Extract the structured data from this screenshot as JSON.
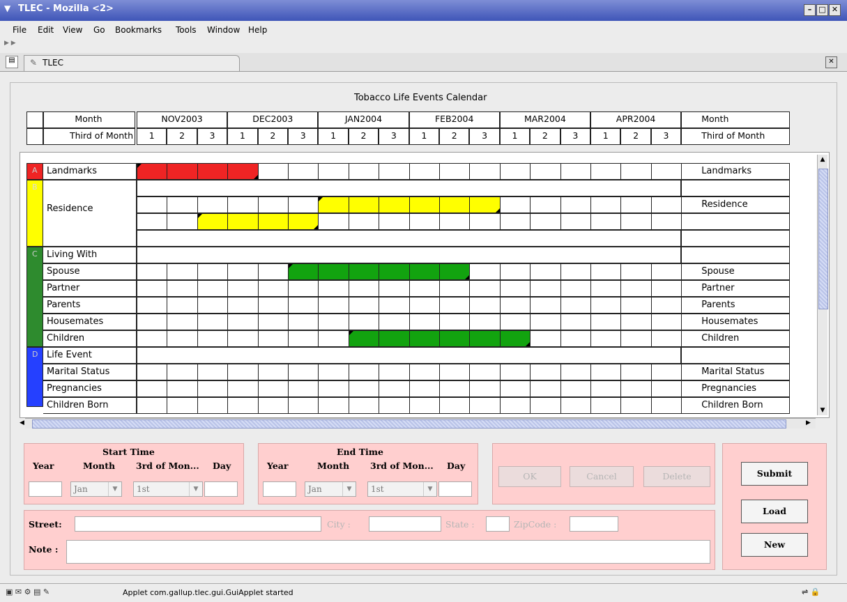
{
  "window": {
    "title": "TLEC - Mozilla <2>"
  },
  "menubar": {
    "items": [
      "File",
      "Edit",
      "View",
      "Go",
      "Bookmarks",
      "Tools",
      "Window",
      "Help"
    ]
  },
  "tab": {
    "label": "TLEC"
  },
  "calendar": {
    "title": "Tobacco Life Events Calendar",
    "month_label": "Month",
    "third_label": "Third of Month",
    "months": [
      "NOV2003",
      "DEC2003",
      "JAN2004",
      "FEB2004",
      "MAR2004",
      "APR2004"
    ],
    "thirds": [
      "1",
      "2",
      "3"
    ]
  },
  "rows": [
    {
      "letter": "A",
      "label": "Landmarks",
      "right": "Landmarks",
      "color": "#ef2424"
    },
    {
      "letter": "B",
      "label": "Residence",
      "right": "Residence",
      "color": "#ffff00"
    },
    {
      "letter": "C",
      "label": "Living With",
      "color": "#2e8b2e"
    },
    {
      "label": "Spouse",
      "right": "Spouse"
    },
    {
      "label": "Partner",
      "right": "Partner"
    },
    {
      "label": "Parents",
      "right": "Parents"
    },
    {
      "label": "Housemates",
      "right": "Housemates"
    },
    {
      "label": "Children",
      "right": "Children"
    },
    {
      "letter": "D",
      "label": "Life Event",
      "color": "#2540ff"
    },
    {
      "label": "Marital Status",
      "right": "Marital Status"
    },
    {
      "label": "Pregnancies",
      "right": "Pregnancies"
    },
    {
      "label": "Children Born",
      "right": "Children Born"
    }
  ],
  "bars": [
    {
      "row": "landmarks",
      "start": 0,
      "end": 4,
      "color": "red"
    },
    {
      "row": "residence-1",
      "start": 6,
      "end": 12,
      "color": "yellow"
    },
    {
      "row": "residence-2",
      "start": 2,
      "end": 6,
      "color": "yellow"
    },
    {
      "row": "spouse",
      "start": 5,
      "end": 11,
      "color": "green"
    },
    {
      "row": "children",
      "start": 7,
      "end": 13,
      "color": "green"
    }
  ],
  "form": {
    "start_title": "Start Time",
    "end_title": "End Time",
    "year": "Year",
    "month": "Month",
    "third": "3rd of Mon...",
    "day": "Day",
    "month_value": "Jan",
    "third_value": "1st",
    "ok": "OK",
    "cancel": "Cancel",
    "delete": "Delete",
    "submit": "Submit",
    "load": "Load",
    "new": "New",
    "street": "Street:",
    "city": "City :",
    "state": "State :",
    "zip": "ZipCode :",
    "note": "Note :"
  },
  "status": {
    "text": "Applet com.gallup.tlec.gui.GuiApplet started"
  }
}
